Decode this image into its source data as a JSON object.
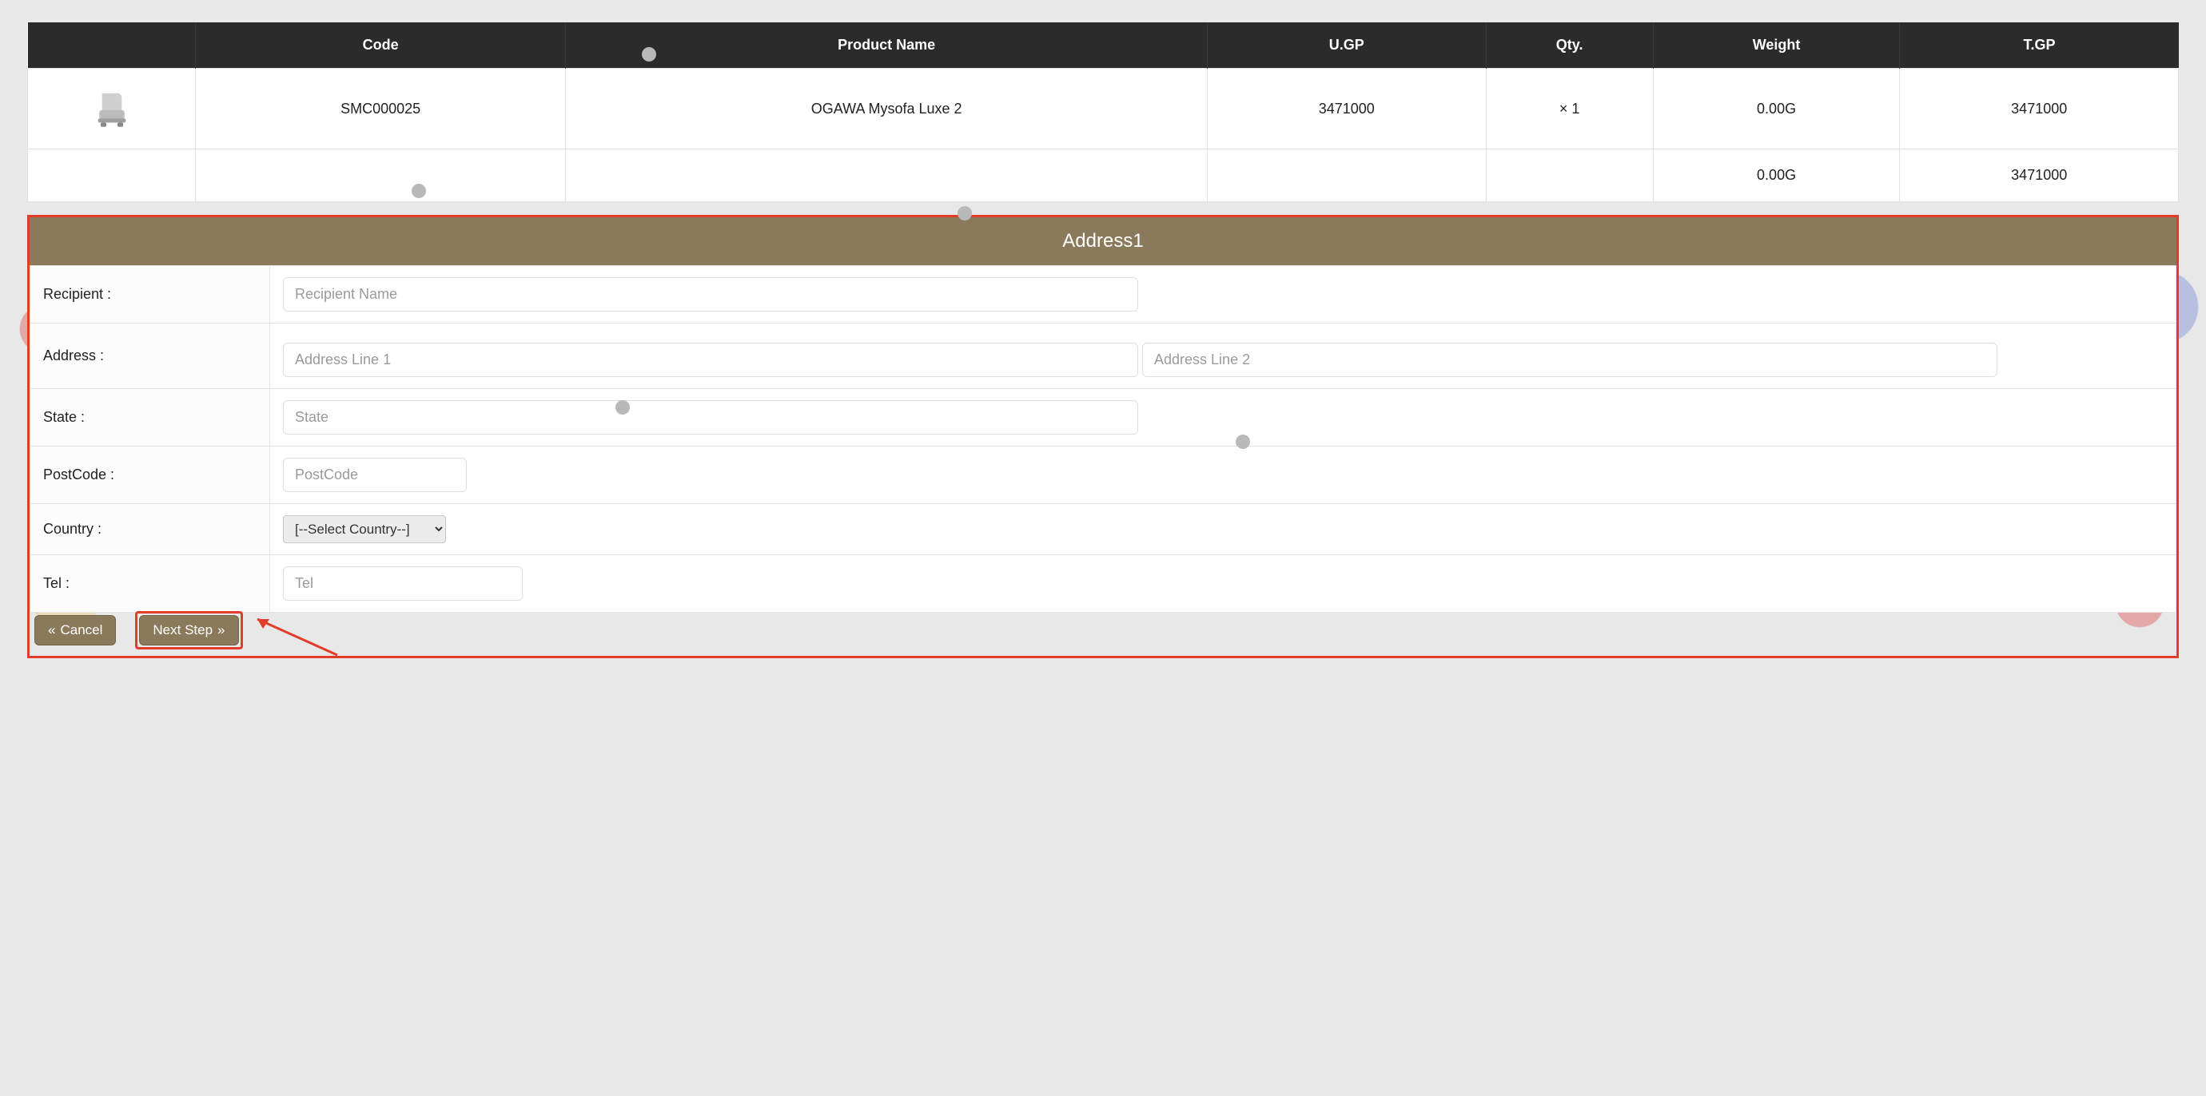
{
  "table": {
    "headers": {
      "image": "",
      "code": "Code",
      "product_name": "Product Name",
      "ugp": "U.GP",
      "qty": "Qty.",
      "weight": "Weight",
      "tgp": "T.GP"
    },
    "rows": [
      {
        "code": "SMC000025",
        "product_name": "OGAWA Mysofa Luxe 2",
        "ugp": "3471000",
        "qty": "× 1",
        "weight": "0.00G",
        "tgp": "3471000"
      }
    ],
    "totals": {
      "weight": "0.00G",
      "tgp": "3471000"
    }
  },
  "address": {
    "title": "Address1",
    "labels": {
      "recipient": "Recipient :",
      "address": "Address :",
      "state": "State :",
      "postcode": "PostCode :",
      "country": "Country :",
      "tel": "Tel :"
    },
    "placeholders": {
      "recipient": "Recipient Name",
      "addr1": "Address Line 1",
      "addr2": "Address Line 2",
      "state": "State",
      "postcode": "PostCode",
      "tel": "Tel"
    },
    "country_select": {
      "selected": "[--Select Country--]"
    }
  },
  "buttons": {
    "cancel": "Cancel",
    "next": "Next Step"
  }
}
